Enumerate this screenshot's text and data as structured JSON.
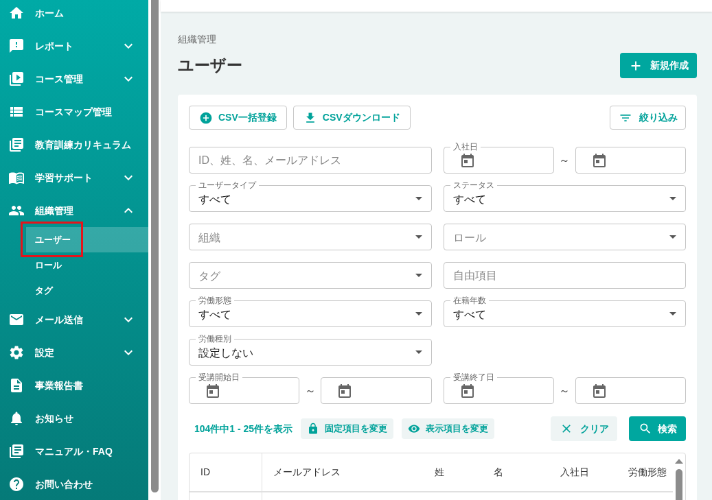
{
  "sidebar": {
    "items": [
      {
        "kind": "link",
        "label": "ホーム",
        "selected": false
      },
      {
        "kind": "group",
        "label": "レポート",
        "selected": false,
        "expanded": false
      },
      {
        "kind": "group",
        "label": "コース管理",
        "selected": false,
        "expanded": false
      },
      {
        "kind": "link",
        "label": "コースマップ管理",
        "selected": false
      },
      {
        "kind": "link",
        "label": "教育訓練カリキュラム",
        "selected": false
      },
      {
        "kind": "group",
        "label": "学習サポート",
        "selected": false,
        "expanded": false
      },
      {
        "kind": "group",
        "label": "組織管理",
        "selected": false,
        "expanded": true,
        "children": [
          {
            "label": "ユーザー",
            "selected": true,
            "highlighted": true
          },
          {
            "label": "ロール",
            "selected": false,
            "highlighted": false
          },
          {
            "label": "タグ",
            "selected": false,
            "highlighted": false
          }
        ]
      },
      {
        "kind": "group",
        "label": "メール送信",
        "selected": false,
        "expanded": false
      },
      {
        "kind": "group",
        "label": "設定",
        "selected": false,
        "expanded": false
      },
      {
        "kind": "link",
        "label": "事業報告書",
        "selected": false
      },
      {
        "kind": "link",
        "label": "お知らせ",
        "selected": false
      },
      {
        "kind": "link",
        "label": "マニュアル・FAQ",
        "selected": false
      },
      {
        "kind": "link",
        "label": "お問い合わせ",
        "selected": false
      }
    ]
  },
  "breadcrumb": "組織管理",
  "page_title": "ユーザー",
  "create_button": "新規作成",
  "toolbar": {
    "buttons": [
      "CSV一括登録",
      "CSVダウンロード"
    ],
    "filter_button": "絞り込み"
  },
  "filters": [
    [
      {
        "kind": "text",
        "placeholder": "ID、姓、名、メールアドレス"
      },
      {
        "kind": "date_range",
        "label": "入社日",
        "separator": "～"
      }
    ],
    [
      {
        "kind": "select",
        "label": "ユーザータイプ",
        "value": "すべて"
      },
      {
        "kind": "select",
        "label": "ステータス",
        "value": "すべて"
      }
    ],
    [
      {
        "kind": "select",
        "placeholder": "組織"
      },
      {
        "kind": "select",
        "placeholder": "ロール"
      }
    ],
    [
      {
        "kind": "select",
        "placeholder": "タグ"
      },
      {
        "kind": "text",
        "placeholder": "自由項目"
      }
    ],
    [
      {
        "kind": "select",
        "label": "労働形態",
        "value": "すべて"
      },
      {
        "kind": "select",
        "label": "在籍年数",
        "value": "すべて"
      }
    ],
    [
      {
        "kind": "select",
        "label": "労働種別",
        "value": "設定しない"
      }
    ],
    [
      {
        "kind": "date_range",
        "label": "受講開始日",
        "separator": "～"
      },
      {
        "kind": "date_range",
        "label": "受講終了日",
        "separator": "～"
      }
    ]
  ],
  "result_count": "104件中1 - 25件を表示",
  "column_buttons": [
    "固定項目を変更",
    "表示項目を変更"
  ],
  "clear_button": "クリア",
  "search_button": "検索",
  "table": {
    "columns": [
      "ID",
      "メールアドレス",
      "姓",
      "名",
      "入社日",
      "労働形態"
    ]
  }
}
